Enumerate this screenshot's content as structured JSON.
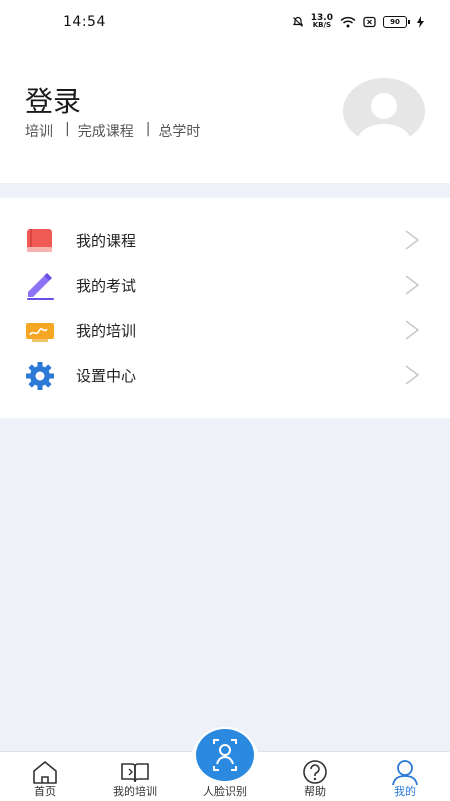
{
  "status_bar": {
    "time": "14:54",
    "net_speed_value": "13.0",
    "net_speed_unit": "KB/S",
    "battery": "90"
  },
  "profile": {
    "title": "登录",
    "stats": [
      {
        "label": "培训"
      },
      {
        "label": "完成课程"
      },
      {
        "label": "总学时"
      }
    ],
    "separator": "|"
  },
  "menu": {
    "items": [
      {
        "label": "我的课程",
        "icon": "book-icon",
        "color": "#ef5a55"
      },
      {
        "label": "我的考试",
        "icon": "pencil-icon",
        "color": "#7a5cf0"
      },
      {
        "label": "我的培训",
        "icon": "training-icon",
        "color": "#f5a623"
      },
      {
        "label": "设置中心",
        "icon": "gear-icon",
        "color": "#2a7ad6"
      }
    ]
  },
  "tabbar": {
    "items": [
      {
        "label": "首页",
        "icon": "home-icon",
        "active": false
      },
      {
        "label": "我的培训",
        "icon": "open-book-icon",
        "active": false
      },
      {
        "label": "人脸识别",
        "icon": "face-recognition-icon",
        "active": false
      },
      {
        "label": "帮助",
        "icon": "help-icon",
        "active": false
      },
      {
        "label": "我的",
        "icon": "user-icon",
        "active": true
      }
    ],
    "active_color": "#2a7ad6"
  }
}
